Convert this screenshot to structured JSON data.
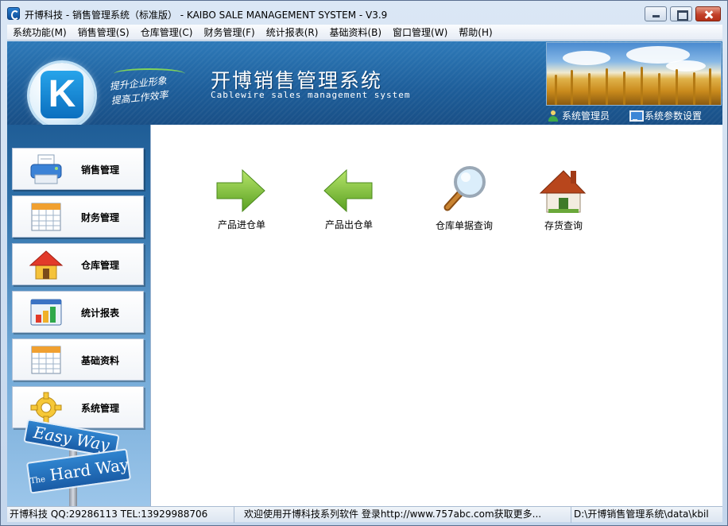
{
  "window": {
    "title": "开博科技 - 销售管理系统（标准版） - KAIBO SALE MANAGEMENT SYSTEM - V3.9"
  },
  "menubar": {
    "items": [
      {
        "label": "系统功能(M)"
      },
      {
        "label": "销售管理(S)"
      },
      {
        "label": "仓库管理(C)"
      },
      {
        "label": "财务管理(F)"
      },
      {
        "label": "统计报表(R)"
      },
      {
        "label": "基础资料(B)"
      },
      {
        "label": "窗口管理(W)"
      },
      {
        "label": "帮助(H)"
      }
    ]
  },
  "banner": {
    "logo_letter": "K",
    "slogan_line1": "提升企业形象",
    "slogan_line2": "提高工作效率",
    "title": "开博销售管理系统",
    "subtitle": "Cablewire sales management system",
    "user_label": "系统管理员",
    "settings_label": "系统参数设置"
  },
  "sidebar": {
    "items": [
      {
        "label": "销售管理",
        "icon": "printer-icon"
      },
      {
        "label": "财务管理",
        "icon": "calendar-icon"
      },
      {
        "label": "仓库管理",
        "icon": "house-icon"
      },
      {
        "label": "统计报表",
        "icon": "bar-chart-icon"
      },
      {
        "label": "基础资料",
        "icon": "calendar-icon"
      },
      {
        "label": "系统管理",
        "icon": "gear-icon"
      }
    ],
    "sign_top": "Easy Way",
    "sign_bottom_the": "The",
    "sign_bottom": "Hard Way"
  },
  "main": {
    "tiles": [
      {
        "label": "产品进仓单",
        "icon": "arrow-right-icon"
      },
      {
        "label": "产品出仓单",
        "icon": "arrow-left-icon"
      },
      {
        "label": "仓库单据查询",
        "icon": "magnifier-icon"
      },
      {
        "label": "存货查询",
        "icon": "house-icon"
      }
    ]
  },
  "statusbar": {
    "company": "开博科技 QQ:29286113 TEL:13929988706",
    "message": "欢迎使用开博科技系列软件  登录http://www.757abc.com获取更多...",
    "path": "D:\\开博销售管理系统\\data\\kbil"
  },
  "colors": {
    "banner_blue": "#1d5d99",
    "arrow_green": "#7cc23a",
    "close_red": "#c2412a"
  }
}
